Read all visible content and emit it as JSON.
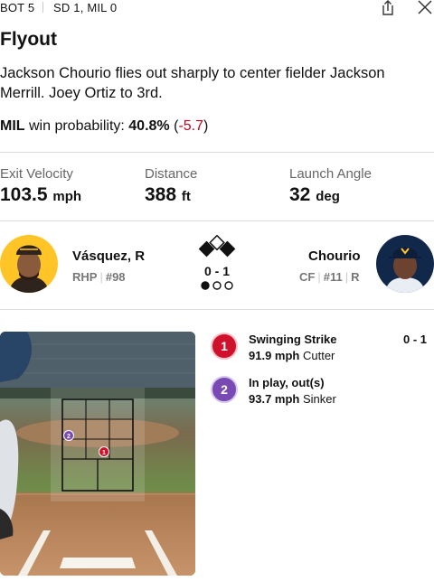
{
  "header": {
    "inning": "BOT 5",
    "score": "SD 1, MIL 0"
  },
  "play": {
    "title": "Flyout",
    "description": "Jackson Chourio flies out sharply to center fielder Jackson Merrill. Joey Ortiz to 3rd.",
    "win_prob_team": "MIL",
    "win_prob_label": "win probability:",
    "win_prob_value": "40.8%",
    "win_prob_open": "(",
    "win_prob_change": "-5.7",
    "win_prob_close": ")"
  },
  "stats": [
    {
      "label": "Exit Velocity",
      "value": "103.5",
      "unit": "mph"
    },
    {
      "label": "Distance",
      "value": "388",
      "unit": "ft"
    },
    {
      "label": "Launch Angle",
      "value": "32",
      "unit": "deg"
    }
  ],
  "matchup": {
    "pitcher": {
      "name": "Vásquez, R",
      "position": "RHP",
      "number": "#98"
    },
    "batter": {
      "name": "Chourio",
      "position": "CF",
      "number": "#11",
      "bats": "R"
    },
    "count": "0 - 1",
    "outs": 1,
    "bases": {
      "first": true,
      "second": false,
      "third": true
    }
  },
  "pitches": [
    {
      "num": "1",
      "result": "Swinging Strike",
      "speed": "91.9 mph",
      "type": "Cutter",
      "count": "0 - 1",
      "color": "#d0112b"
    },
    {
      "num": "2",
      "result": "In play, out(s)",
      "speed": "93.7 mph",
      "type": "Sinker",
      "count": "",
      "color": "#7a4ab4"
    }
  ],
  "colors": {
    "negative": "#c4001e",
    "padres_gold": "#ffc425",
    "brewers_navy": "#12284b"
  }
}
